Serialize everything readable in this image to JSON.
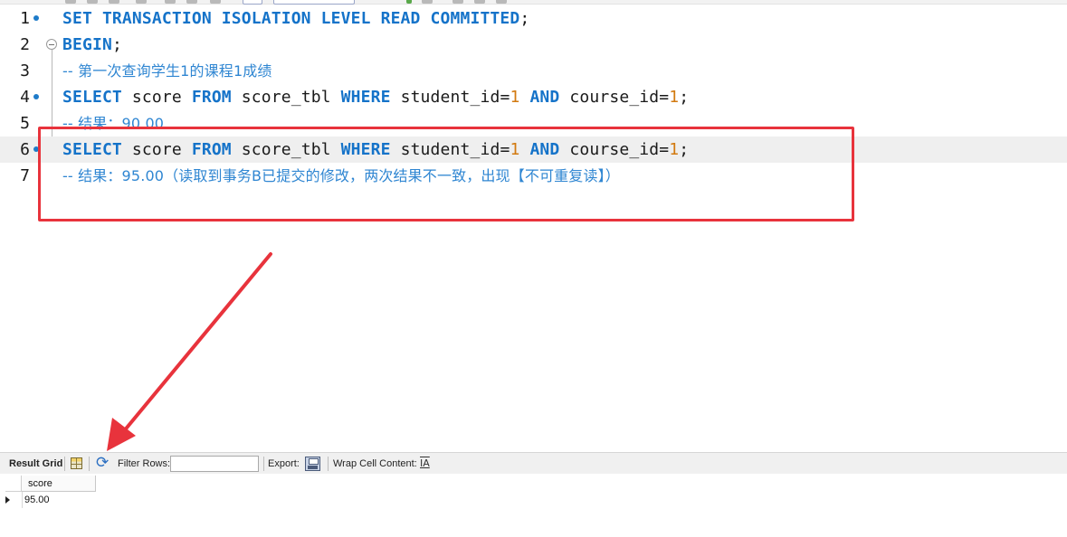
{
  "editor": {
    "lines": [
      {
        "num": "1",
        "marker": true,
        "fold": false,
        "tokens": [
          {
            "t": "SET TRANSACTION ISOLATION LEVEL READ COMMITTED",
            "c": "kw"
          },
          {
            "t": ";",
            "c": ""
          }
        ]
      },
      {
        "num": "2",
        "marker": false,
        "fold": true,
        "tokens": [
          {
            "t": "BEGIN",
            "c": "kw"
          },
          {
            "t": ";",
            "c": ""
          }
        ]
      },
      {
        "num": "3",
        "marker": false,
        "fold": false,
        "tokens": [
          {
            "t": "-- 第一次查询学生",
            "c": "cm"
          },
          {
            "t": "1",
            "c": "cm m"
          },
          {
            "t": "的课程",
            "c": "cm"
          },
          {
            "t": "1",
            "c": "cm m"
          },
          {
            "t": "成绩",
            "c": "cm"
          }
        ]
      },
      {
        "num": "4",
        "marker": true,
        "fold": false,
        "tokens": [
          {
            "t": "SELECT",
            "c": "kw"
          },
          {
            "t": " score ",
            "c": ""
          },
          {
            "t": "FROM",
            "c": "kw"
          },
          {
            "t": " score_tbl ",
            "c": ""
          },
          {
            "t": "WHERE",
            "c": "kw"
          },
          {
            "t": " student_id=",
            "c": ""
          },
          {
            "t": "1",
            "c": "num"
          },
          {
            "t": " ",
            "c": ""
          },
          {
            "t": "AND",
            "c": "kw"
          },
          {
            "t": " course_id=",
            "c": ""
          },
          {
            "t": "1",
            "c": "num"
          },
          {
            "t": ";",
            "c": ""
          }
        ]
      },
      {
        "num": "5",
        "marker": false,
        "fold": false,
        "tokens": [
          {
            "t": "-- 结果：",
            "c": "cm"
          },
          {
            "t": "90.00",
            "c": "cm m"
          }
        ]
      },
      {
        "num": "6",
        "marker": true,
        "fold": false,
        "current": true,
        "tokens": [
          {
            "t": "SELECT",
            "c": "kw"
          },
          {
            "t": " score ",
            "c": ""
          },
          {
            "t": "FROM",
            "c": "kw"
          },
          {
            "t": " score_tbl ",
            "c": ""
          },
          {
            "t": "WHERE",
            "c": "kw"
          },
          {
            "t": " student_id=",
            "c": ""
          },
          {
            "t": "1",
            "c": "num"
          },
          {
            "t": " ",
            "c": ""
          },
          {
            "t": "AND",
            "c": "kw"
          },
          {
            "t": " course_id=",
            "c": ""
          },
          {
            "t": "1",
            "c": "num"
          },
          {
            "t": ";",
            "c": ""
          }
        ]
      },
      {
        "num": "7",
        "marker": false,
        "fold": false,
        "tokens": [
          {
            "t": "-- 结果：",
            "c": "cm"
          },
          {
            "t": "95.00",
            "c": "cm m"
          },
          {
            "t": "（读取到事务",
            "c": "cm"
          },
          {
            "t": "B",
            "c": "cm m"
          },
          {
            "t": "已提交的修改，两次结果不一致，出现【不可重复读】）",
            "c": "cm"
          }
        ]
      }
    ]
  },
  "result_toolbar": {
    "result_grid_label": "Result Grid",
    "filter_rows_label": "Filter Rows:",
    "filter_rows_value": "",
    "export_label": "Export:",
    "wrap_label": "Wrap Cell Content:",
    "wrap_icon_glyph": "IA",
    "refresh_glyph": "⟳"
  },
  "result_grid": {
    "columns": [
      "score"
    ],
    "rows": [
      [
        "95.00"
      ]
    ]
  },
  "colors": {
    "keyword": "#1573c9",
    "number": "#d27a10",
    "comment": "#2f86d2",
    "annotation": "#e8333c"
  }
}
